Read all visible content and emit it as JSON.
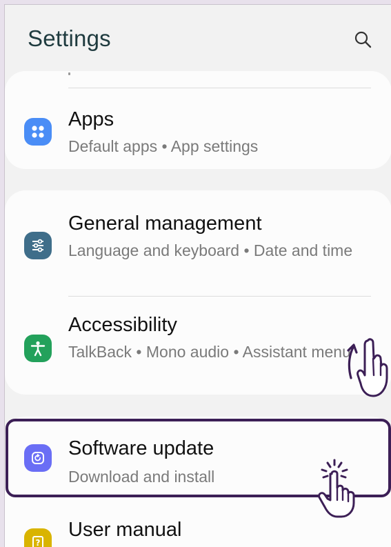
{
  "header": {
    "title": "Settings",
    "search_icon": "search-icon"
  },
  "rows": {
    "apps": {
      "title": "Apps",
      "subtitle": "Default apps  •  App settings",
      "icon": "apps-icon",
      "icon_color": "#4a8df6"
    },
    "general": {
      "title": "General management",
      "subtitle": "Language and keyboard  •  Date and time",
      "icon": "sliders-icon",
      "icon_color": "#3f6e8a"
    },
    "accessibility": {
      "title": "Accessibility",
      "subtitle": "TalkBack  •  Mono audio  •  Assistant menu",
      "icon": "accessibility-person-icon",
      "icon_color": "#23a15b"
    },
    "software_update": {
      "title": "Software update",
      "subtitle": "Download and install",
      "icon": "update-icon",
      "icon_color": "#6a6ef5"
    },
    "user_manual": {
      "title": "User manual",
      "icon": "manual-icon",
      "icon_color": "#d9b400"
    }
  },
  "overlays": {
    "swipe_gesture_icon": "swipe-up-hand-icon",
    "tap_gesture_icon": "tap-hand-icon",
    "highlight_color": "#3c1f56"
  }
}
